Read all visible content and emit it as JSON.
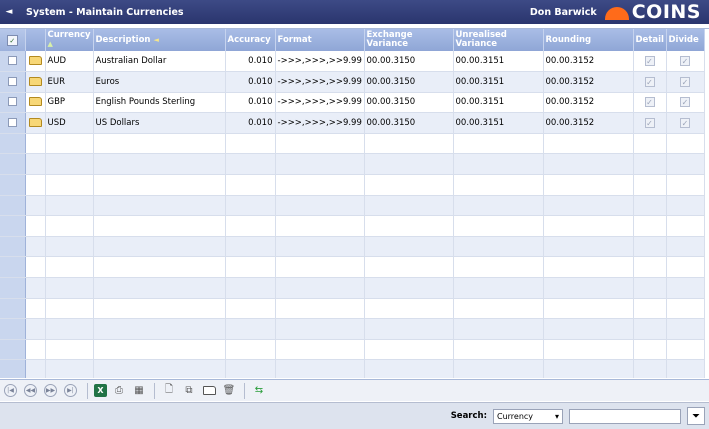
{
  "header": {
    "back_glyph": "◄",
    "title": "System - Maintain Currencies",
    "user": "Don Barwick",
    "logo_text": "COINS"
  },
  "table": {
    "columns": [
      "Currency",
      "Description",
      "Accuracy",
      "Format",
      "Exchange Variance",
      "Unrealised Variance",
      "Rounding",
      "Detail",
      "Divide"
    ],
    "rows": [
      {
        "currency": "AUD",
        "description": "Australian Dollar",
        "accuracy": "0.010",
        "format": "->>>,>>>,>>9.99",
        "exchange": "00.00.3150",
        "unrealised": "00.00.3151",
        "rounding": "00.00.3152"
      },
      {
        "currency": "EUR",
        "description": "Euros",
        "accuracy": "0.010",
        "format": "->>>,>>>,>>9.99",
        "exchange": "00.00.3150",
        "unrealised": "00.00.3151",
        "rounding": "00.00.3152"
      },
      {
        "currency": "GBP",
        "description": "English Pounds Sterling",
        "accuracy": "0.010",
        "format": "->>>,>>>,>>9.99",
        "exchange": "00.00.3150",
        "unrealised": "00.00.3151",
        "rounding": "00.00.3152"
      },
      {
        "currency": "USD",
        "description": "US Dollars",
        "accuracy": "0.010",
        "format": "->>>,>>>,>>9.99",
        "exchange": "00.00.3150",
        "unrealised": "00.00.3151",
        "rounding": "00.00.3152"
      }
    ]
  },
  "search": {
    "label": "Search:",
    "field_value": "Currency",
    "input_value": ""
  },
  "colors": {
    "title_bar": "#2f3a75",
    "header": "#8fa6d6",
    "logo_accent": "#ff6b1a"
  },
  "icons": [
    "first-page-icon",
    "previous-page-icon",
    "next-page-icon",
    "last-page-icon",
    "excel-icon",
    "print-icon",
    "calculator-icon",
    "new-document-icon",
    "copy-icon",
    "open-folder-icon",
    "delete-icon",
    "refresh-icon",
    "filter-icon"
  ]
}
